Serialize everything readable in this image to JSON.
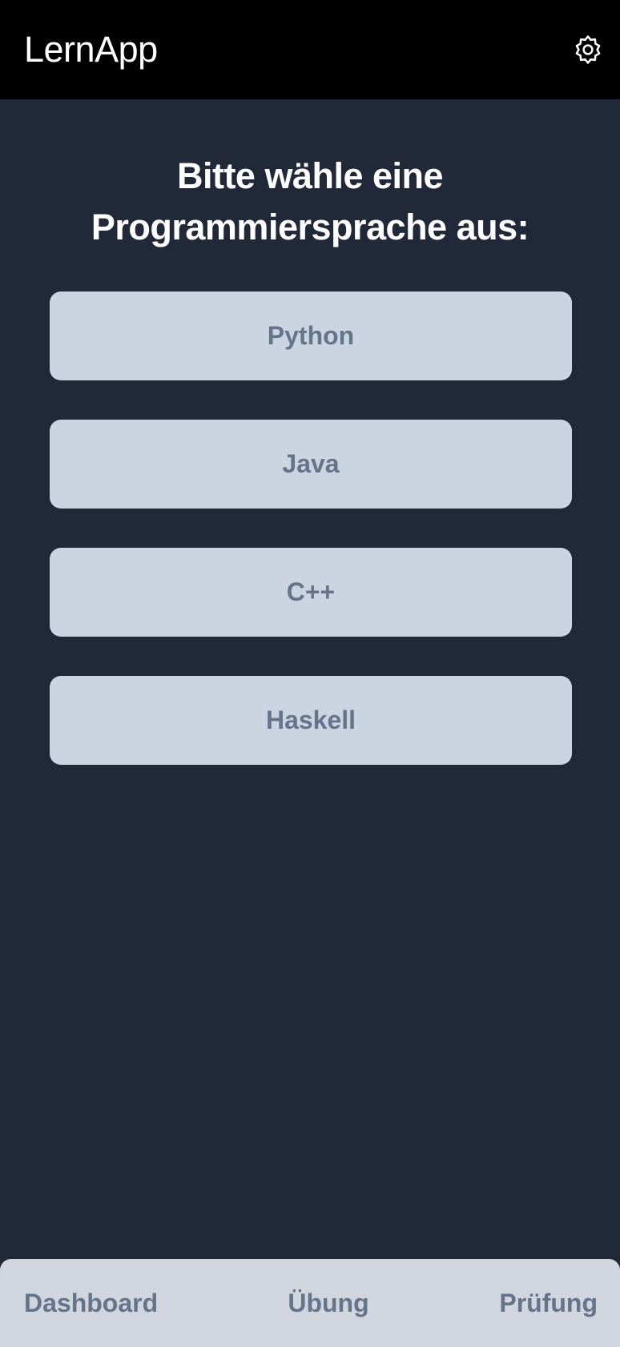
{
  "header": {
    "title": "LernApp",
    "settings_icon": "gear-icon"
  },
  "main": {
    "heading_line1": "Bitte wähle eine",
    "heading_line2": "Programmiersprache aus:",
    "languages": [
      {
        "label": "Python"
      },
      {
        "label": "Java"
      },
      {
        "label": "C++"
      },
      {
        "label": "Haskell"
      }
    ]
  },
  "bottom_nav": {
    "items": [
      {
        "label": "Dashboard"
      },
      {
        "label": "Übung"
      },
      {
        "label": "Prüfung"
      }
    ]
  },
  "colors": {
    "background": "#212837",
    "header": "#000000",
    "button_bg": "#cbd5e1",
    "button_text": "#64748b",
    "nav_bg": "#d1d5de"
  }
}
